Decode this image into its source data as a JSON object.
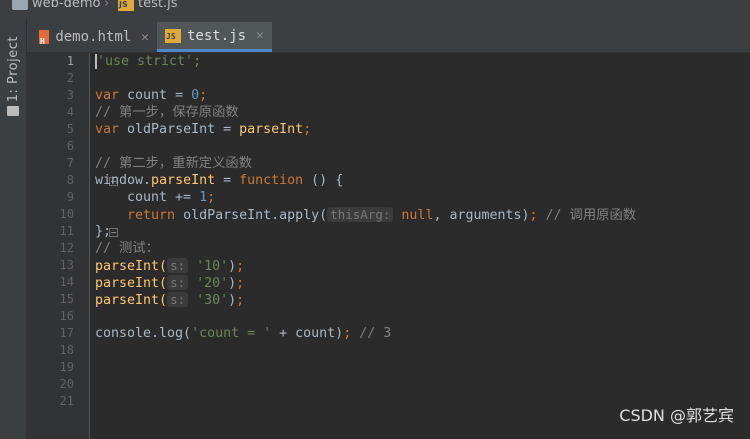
{
  "breadcrumb": {
    "project": "web-demo",
    "file": "test.js"
  },
  "sidebar": {
    "project_tab_label": "1: Project"
  },
  "tabs": [
    {
      "label": "demo.html",
      "icon": "html-file-icon",
      "active": false
    },
    {
      "label": "test.js",
      "icon": "js-file-icon",
      "active": true
    }
  ],
  "editor": {
    "current_line": 1,
    "line_numbers": [
      "1",
      "2",
      "3",
      "4",
      "5",
      "6",
      "7",
      "8",
      "9",
      "10",
      "11",
      "12",
      "13",
      "14",
      "15",
      "16",
      "17",
      "18",
      "19",
      "20",
      "21"
    ],
    "lines": {
      "l1": [
        "'use strict';"
      ],
      "l3": [
        "var",
        " count = ",
        "0",
        ";"
      ],
      "l4": [
        "// 第一步，保存原函数"
      ],
      "l5": [
        "var",
        " oldParseInt = ",
        "parseInt",
        ";"
      ],
      "l7": [
        "// 第二步，重新定义函数"
      ],
      "l8": [
        "window.",
        "parseInt",
        " = ",
        "function",
        " () {"
      ],
      "l9": [
        "    count += ",
        "1",
        ";"
      ],
      "l10": [
        "    ",
        "return",
        " oldParseInt.apply(",
        "thisArg:",
        " null",
        ", arguments)",
        ";",
        " // 调用原函数"
      ],
      "l11": [
        "};"
      ],
      "l12": [
        "// 测试："
      ],
      "l13": [
        "parseInt(",
        "s:",
        " '10'",
        ")",
        ";"
      ],
      "l14": [
        "parseInt(",
        "s:",
        " '20'",
        ")",
        ";"
      ],
      "l15": [
        "parseInt(",
        "s:",
        " '30'",
        ")",
        ";"
      ],
      "l17": [
        "console.log(",
        "'count = '",
        " + count)",
        ";",
        " // 3"
      ]
    }
  },
  "watermark": "CSDN @郭艺宾",
  "colors": {
    "background": "#2b2b2b",
    "keyword": "#cc7832",
    "string": "#6a8759",
    "number": "#6897bb",
    "comment": "#808080",
    "function": "#ffc66d",
    "text": "#a9b7c6"
  }
}
